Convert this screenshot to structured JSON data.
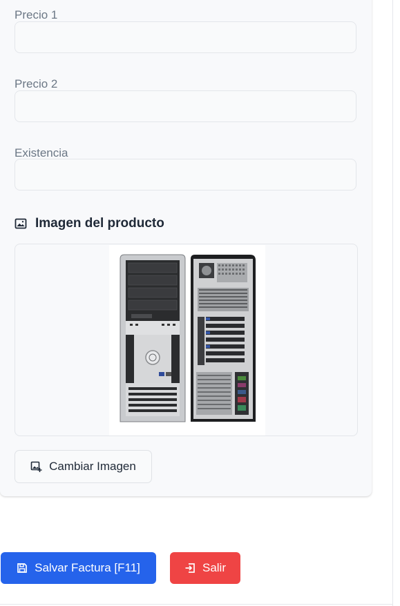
{
  "form": {
    "fields": [
      {
        "label": "Precio 1",
        "value": "",
        "placeholder": ""
      },
      {
        "label": "Precio 2",
        "value": "",
        "placeholder": ""
      },
      {
        "label": "Existencia",
        "value": "",
        "placeholder": ""
      }
    ]
  },
  "image_section": {
    "title": "Imagen del producto",
    "icon": "image-icon",
    "product_image": "desktop-tower-computer-front-and-back",
    "change_button_label": "Cambiar Imagen",
    "change_button_icon": "image-add-icon"
  },
  "actions": {
    "save_label": "Salvar Factura [F11]",
    "save_icon": "save-icon",
    "save_color": "#2563eb",
    "exit_label": "Salir",
    "exit_icon": "exit-icon",
    "exit_color": "#ef4444"
  }
}
